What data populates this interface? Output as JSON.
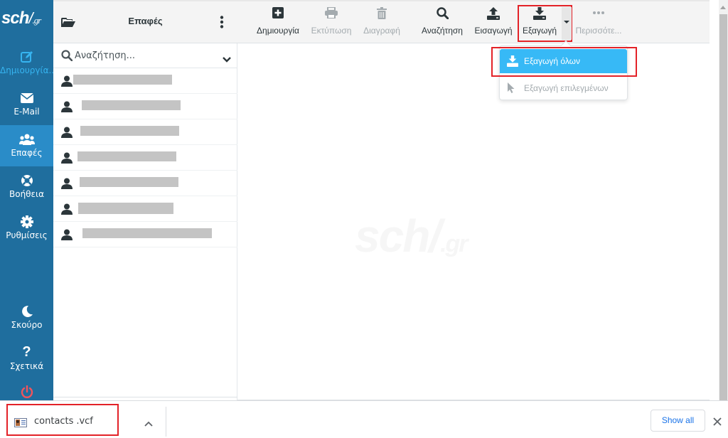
{
  "brand": {
    "logo_main": "sch",
    "logo_slash": "/",
    "logo_suffix": ".gr"
  },
  "sidebar": {
    "items": [
      {
        "id": "compose",
        "label": "Δημιουργία...",
        "icon": "compose-icon"
      },
      {
        "id": "email",
        "label": "E-Mail",
        "icon": "envelope-icon"
      },
      {
        "id": "contacts",
        "label": "Επαφές",
        "icon": "users-icon",
        "active": true
      },
      {
        "id": "help",
        "label": "Βοήθεια",
        "icon": "lifebuoy-icon"
      },
      {
        "id": "settings",
        "label": "Ρυθμίσεις",
        "icon": "gear-icon"
      }
    ],
    "bottom_items": [
      {
        "id": "dark",
        "label": "Σκούρο",
        "icon": "moon-icon"
      },
      {
        "id": "about",
        "label": "Σχετικά",
        "icon": "question-icon"
      },
      {
        "id": "logout",
        "label": "",
        "icon": "power-icon"
      }
    ]
  },
  "contacts_panel": {
    "title": "Επαφές",
    "search_placeholder": "Αναζήτηση...",
    "contacts": [
      {
        "name": "[redacted]"
      },
      {
        "name": "[redacted]"
      },
      {
        "name": "[redacted]"
      },
      {
        "name": "[redacted]"
      },
      {
        "name": "[redacted]"
      },
      {
        "name": "[redacted]"
      },
      {
        "name": "[redacted]"
      }
    ]
  },
  "toolbar": {
    "buttons": [
      {
        "id": "create",
        "label": "Δημιουργία",
        "icon": "plus-square-icon",
        "disabled": false
      },
      {
        "id": "print",
        "label": "Εκτύπωση",
        "icon": "printer-icon",
        "disabled": true
      },
      {
        "id": "delete",
        "label": "Διαγραφή",
        "icon": "trash-icon",
        "disabled": true
      },
      {
        "id": "search",
        "label": "Αναζήτηση",
        "icon": "search-icon",
        "disabled": false
      },
      {
        "id": "import",
        "label": "Εισαγωγή",
        "icon": "upload-icon",
        "disabled": false
      },
      {
        "id": "export",
        "label": "Εξαγωγή",
        "icon": "download-icon",
        "disabled": false
      },
      {
        "id": "more",
        "label": "Περισσότε...",
        "icon": "ellipsis-icon",
        "disabled": true
      }
    ]
  },
  "export_menu": {
    "items": [
      {
        "id": "export-all",
        "label": "Εξαγωγή όλων",
        "icon": "download-icon",
        "selected": true
      },
      {
        "id": "export-selected",
        "label": "Εξαγωγή επιλεγμένων",
        "icon": "cursor-icon",
        "disabled": true
      }
    ]
  },
  "watermark": {
    "main": "sch",
    "slash": "/",
    "suffix": ".gr"
  },
  "download_bar": {
    "file_name": "contacts  .vcf",
    "show_all_label": "Show all"
  },
  "colors": {
    "sidebar_bg": "#1f6e9e",
    "sidebar_active": "#2a8cc8",
    "accent": "#37b9f6",
    "highlight_box": "#e32228",
    "logout": "#f0545c"
  }
}
